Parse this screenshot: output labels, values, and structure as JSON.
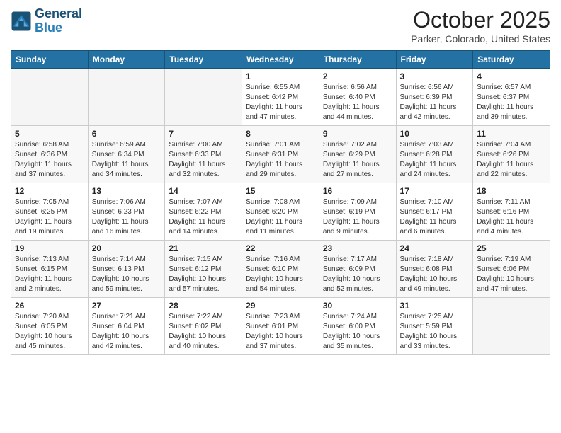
{
  "header": {
    "logo_line1": "General",
    "logo_line2": "Blue",
    "month_title": "October 2025",
    "location": "Parker, Colorado, United States"
  },
  "weekdays": [
    "Sunday",
    "Monday",
    "Tuesday",
    "Wednesday",
    "Thursday",
    "Friday",
    "Saturday"
  ],
  "weeks": [
    [
      {
        "day": "",
        "info": ""
      },
      {
        "day": "",
        "info": ""
      },
      {
        "day": "",
        "info": ""
      },
      {
        "day": "1",
        "info": "Sunrise: 6:55 AM\nSunset: 6:42 PM\nDaylight: 11 hours\nand 47 minutes."
      },
      {
        "day": "2",
        "info": "Sunrise: 6:56 AM\nSunset: 6:40 PM\nDaylight: 11 hours\nand 44 minutes."
      },
      {
        "day": "3",
        "info": "Sunrise: 6:56 AM\nSunset: 6:39 PM\nDaylight: 11 hours\nand 42 minutes."
      },
      {
        "day": "4",
        "info": "Sunrise: 6:57 AM\nSunset: 6:37 PM\nDaylight: 11 hours\nand 39 minutes."
      }
    ],
    [
      {
        "day": "5",
        "info": "Sunrise: 6:58 AM\nSunset: 6:36 PM\nDaylight: 11 hours\nand 37 minutes."
      },
      {
        "day": "6",
        "info": "Sunrise: 6:59 AM\nSunset: 6:34 PM\nDaylight: 11 hours\nand 34 minutes."
      },
      {
        "day": "7",
        "info": "Sunrise: 7:00 AM\nSunset: 6:33 PM\nDaylight: 11 hours\nand 32 minutes."
      },
      {
        "day": "8",
        "info": "Sunrise: 7:01 AM\nSunset: 6:31 PM\nDaylight: 11 hours\nand 29 minutes."
      },
      {
        "day": "9",
        "info": "Sunrise: 7:02 AM\nSunset: 6:29 PM\nDaylight: 11 hours\nand 27 minutes."
      },
      {
        "day": "10",
        "info": "Sunrise: 7:03 AM\nSunset: 6:28 PM\nDaylight: 11 hours\nand 24 minutes."
      },
      {
        "day": "11",
        "info": "Sunrise: 7:04 AM\nSunset: 6:26 PM\nDaylight: 11 hours\nand 22 minutes."
      }
    ],
    [
      {
        "day": "12",
        "info": "Sunrise: 7:05 AM\nSunset: 6:25 PM\nDaylight: 11 hours\nand 19 minutes."
      },
      {
        "day": "13",
        "info": "Sunrise: 7:06 AM\nSunset: 6:23 PM\nDaylight: 11 hours\nand 16 minutes."
      },
      {
        "day": "14",
        "info": "Sunrise: 7:07 AM\nSunset: 6:22 PM\nDaylight: 11 hours\nand 14 minutes."
      },
      {
        "day": "15",
        "info": "Sunrise: 7:08 AM\nSunset: 6:20 PM\nDaylight: 11 hours\nand 11 minutes."
      },
      {
        "day": "16",
        "info": "Sunrise: 7:09 AM\nSunset: 6:19 PM\nDaylight: 11 hours\nand 9 minutes."
      },
      {
        "day": "17",
        "info": "Sunrise: 7:10 AM\nSunset: 6:17 PM\nDaylight: 11 hours\nand 6 minutes."
      },
      {
        "day": "18",
        "info": "Sunrise: 7:11 AM\nSunset: 6:16 PM\nDaylight: 11 hours\nand 4 minutes."
      }
    ],
    [
      {
        "day": "19",
        "info": "Sunrise: 7:13 AM\nSunset: 6:15 PM\nDaylight: 11 hours\nand 2 minutes."
      },
      {
        "day": "20",
        "info": "Sunrise: 7:14 AM\nSunset: 6:13 PM\nDaylight: 10 hours\nand 59 minutes."
      },
      {
        "day": "21",
        "info": "Sunrise: 7:15 AM\nSunset: 6:12 PM\nDaylight: 10 hours\nand 57 minutes."
      },
      {
        "day": "22",
        "info": "Sunrise: 7:16 AM\nSunset: 6:10 PM\nDaylight: 10 hours\nand 54 minutes."
      },
      {
        "day": "23",
        "info": "Sunrise: 7:17 AM\nSunset: 6:09 PM\nDaylight: 10 hours\nand 52 minutes."
      },
      {
        "day": "24",
        "info": "Sunrise: 7:18 AM\nSunset: 6:08 PM\nDaylight: 10 hours\nand 49 minutes."
      },
      {
        "day": "25",
        "info": "Sunrise: 7:19 AM\nSunset: 6:06 PM\nDaylight: 10 hours\nand 47 minutes."
      }
    ],
    [
      {
        "day": "26",
        "info": "Sunrise: 7:20 AM\nSunset: 6:05 PM\nDaylight: 10 hours\nand 45 minutes."
      },
      {
        "day": "27",
        "info": "Sunrise: 7:21 AM\nSunset: 6:04 PM\nDaylight: 10 hours\nand 42 minutes."
      },
      {
        "day": "28",
        "info": "Sunrise: 7:22 AM\nSunset: 6:02 PM\nDaylight: 10 hours\nand 40 minutes."
      },
      {
        "day": "29",
        "info": "Sunrise: 7:23 AM\nSunset: 6:01 PM\nDaylight: 10 hours\nand 37 minutes."
      },
      {
        "day": "30",
        "info": "Sunrise: 7:24 AM\nSunset: 6:00 PM\nDaylight: 10 hours\nand 35 minutes."
      },
      {
        "day": "31",
        "info": "Sunrise: 7:25 AM\nSunset: 5:59 PM\nDaylight: 10 hours\nand 33 minutes."
      },
      {
        "day": "",
        "info": ""
      }
    ]
  ]
}
